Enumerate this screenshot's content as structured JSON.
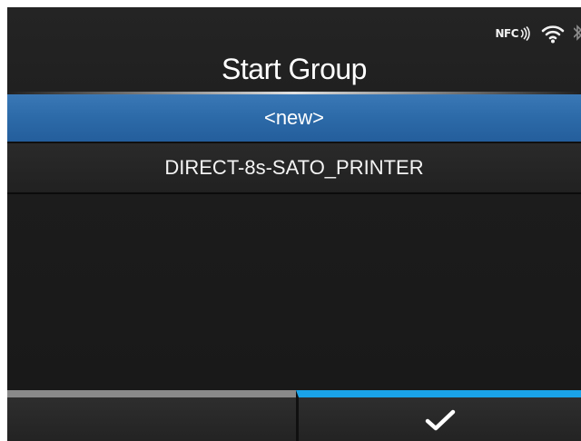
{
  "screen": {
    "title": "Start Group"
  },
  "status_icons": {
    "nfc_label": "NFC",
    "icons": [
      "nfc-icon",
      "wifi-icon",
      "bluetooth-icon"
    ]
  },
  "list": {
    "items": [
      {
        "label": "<new>",
        "selected": true
      },
      {
        "label": "DIRECT-8s-SATO_PRINTER",
        "selected": false
      }
    ]
  },
  "buttons": {
    "left": {
      "label": ""
    },
    "right": {
      "icon": "check-icon"
    }
  },
  "colors": {
    "selected_row": "#2c6aa8",
    "confirm_accent": "#1aa3e8",
    "back_accent": "#8a8a8a",
    "background": "#1c1c1c"
  }
}
